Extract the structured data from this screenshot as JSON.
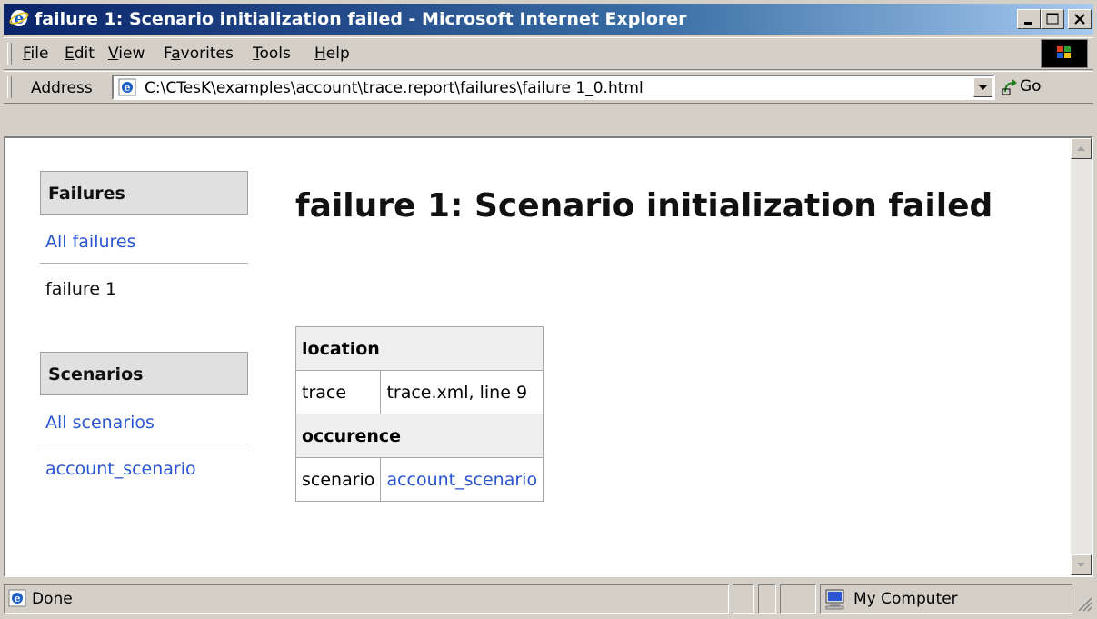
{
  "window": {
    "title": "failure 1: Scenario initialization failed - Microsoft Internet Explorer"
  },
  "menu": {
    "items": [
      {
        "label": "File",
        "key": "F",
        "rest": "ile"
      },
      {
        "label": "Edit",
        "key": "E",
        "rest": "dit"
      },
      {
        "label": "View",
        "key": "V",
        "rest": "iew"
      },
      {
        "label": "Favorites",
        "pre": "F",
        "key": "a",
        "rest": "vorites"
      },
      {
        "label": "Tools",
        "key": "T",
        "rest": "ools"
      },
      {
        "label": "Help",
        "key": "H",
        "rest": "elp"
      }
    ]
  },
  "address": {
    "label": "Address",
    "value": "C:\\CTesK\\examples\\account\\trace.report\\failures\\failure 1_0.html",
    "go_label": "Go"
  },
  "sidebar": {
    "failures_heading": "Failures",
    "all_failures_link": "All failures",
    "current_failure": "failure 1",
    "scenarios_heading": "Scenarios",
    "all_scenarios_link": "All scenarios",
    "scenario_link": "account_scenario"
  },
  "page": {
    "heading": "failure 1: Scenario initialization failed"
  },
  "info_table": {
    "location_heading": "location",
    "trace_label": "trace",
    "trace_value": "trace.xml, line 9",
    "occurence_heading": "occurence",
    "scenario_label": "scenario",
    "scenario_value": "account_scenario"
  },
  "status": {
    "text": "Done",
    "zone": "My Computer"
  }
}
